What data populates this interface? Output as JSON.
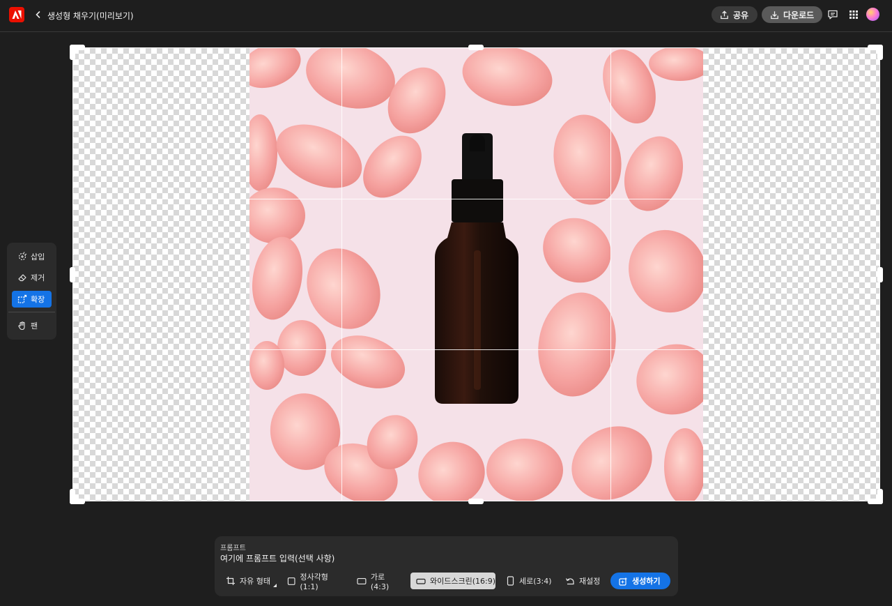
{
  "header": {
    "title": "생성형 채우기(미리보기)",
    "share_label": "공유",
    "download_label": "다운로드",
    "icons": [
      "adobe-logo-icon",
      "back-chevron-icon",
      "share-icon",
      "download-icon",
      "comment-icon",
      "apps-grid-icon",
      "avatar"
    ]
  },
  "tools": {
    "insert_label": "삽입",
    "remove_label": "제거",
    "expand_label": "확장",
    "pan_label": "팬",
    "active": "확장"
  },
  "prompt": {
    "label": "프롬프트",
    "placeholder": "여기에 프롬프트 입력(선택 사항)"
  },
  "aspect_options": {
    "free_label": "자유 형태",
    "square_label": "정사각형(1:1)",
    "landscape_label": "가로(4:3)",
    "widescreen_label": "와이드스크린(16:9)",
    "portrait_label": "세로(3:4)",
    "reset_label": "재설정",
    "selected": "와이드스크린(16:9)"
  },
  "generate_label": "생성하기",
  "colors": {
    "accent": "#1473e6",
    "adobe_red": "#eb1000",
    "background": "#1e1e1e",
    "panel": "#2b2b2b"
  }
}
